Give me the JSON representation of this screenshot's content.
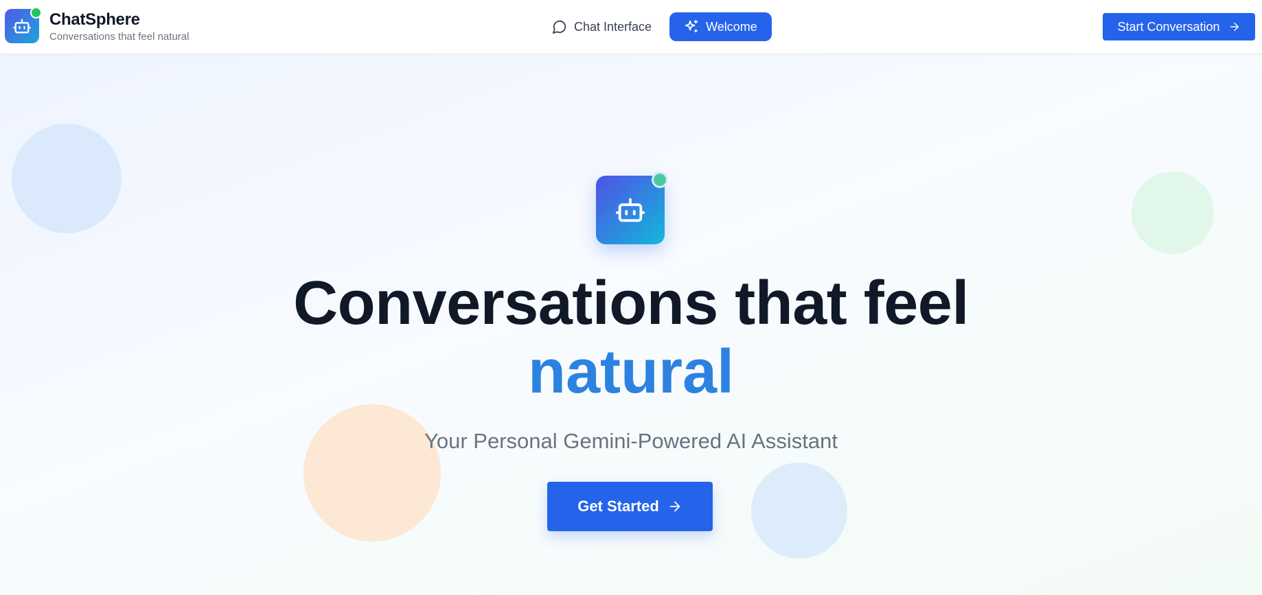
{
  "brand": {
    "name": "ChatSphere",
    "tagline": "Conversations that feel natural",
    "logo_icon": "robot-icon",
    "status_color": "#22c55e"
  },
  "nav": {
    "items": [
      {
        "label": "Chat Interface",
        "icon": "message-circle-icon",
        "active": false
      },
      {
        "label": "Welcome",
        "icon": "sparkles-icon",
        "active": true
      }
    ]
  },
  "header_cta": {
    "label": "Start Conversation",
    "icon": "arrow-right-icon"
  },
  "hero": {
    "icon": "robot-icon",
    "headline": "Conversations that feel",
    "headline_accent": "natural",
    "subtitle": "Your Personal Gemini-Powered AI Assistant",
    "cta_label": "Get Started",
    "cta_icon": "arrow-right-icon"
  },
  "colors": {
    "primary": "#2563eb",
    "accent_text": "#2c82e0",
    "heading": "#111827",
    "muted": "#6b7280"
  }
}
